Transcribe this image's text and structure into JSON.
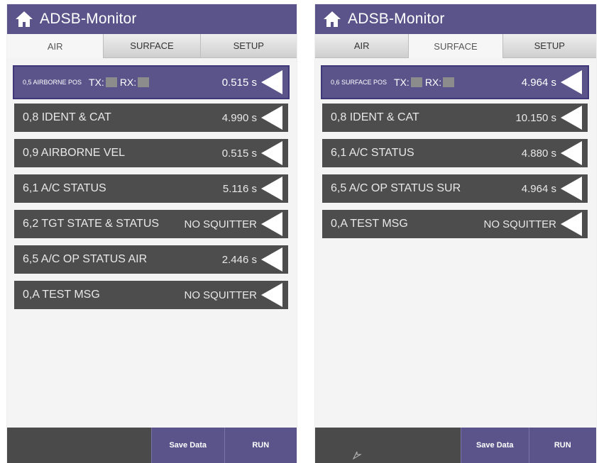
{
  "left": {
    "title": "ADSB-Monitor",
    "tabs": [
      "AIR",
      "SURFACE",
      "SETUP"
    ],
    "active_tab": "AIR",
    "selected": {
      "label": "0,5 AIRBORNE POS",
      "tx": "TX:",
      "rx": "RX:",
      "value": "0.515 s"
    },
    "rows": [
      {
        "label": "0,8 IDENT & CAT",
        "value": "4.990 s"
      },
      {
        "label": "0,9 AIRBORNE VEL",
        "value": "0.515 s"
      },
      {
        "label": "6,1 A/C STATUS",
        "value": "5.116 s"
      },
      {
        "label": "6,2 TGT STATE & STATUS",
        "value": "NO SQUITTER"
      },
      {
        "label": "6,5 A/C OP STATUS AIR",
        "value": "2.446 s"
      },
      {
        "label": "0,A TEST MSG",
        "value": "NO SQUITTER"
      }
    ],
    "buttons": {
      "save": "Save Data",
      "run": "RUN"
    }
  },
  "right": {
    "title": "ADSB-Monitor",
    "tabs": [
      "AIR",
      "SURFACE",
      "SETUP"
    ],
    "active_tab": "SURFACE",
    "selected": {
      "label": "0,6 SURFACE POS",
      "tx": "TX:",
      "rx": "RX:",
      "value": "4.964 s"
    },
    "rows": [
      {
        "label": "0,8 IDENT & CAT",
        "value": "10.150 s"
      },
      {
        "label": "6,1 A/C STATUS",
        "value": "4.880 s"
      },
      {
        "label": "6,5 A/C OP STATUS SUR",
        "value": "4.964 s"
      },
      {
        "label": "0,A TEST MSG",
        "value": "NO SQUITTER"
      }
    ],
    "buttons": {
      "save": "Save Data",
      "run": "RUN"
    }
  },
  "colors": {
    "accent": "#5b548a",
    "row_bg": "#4d4d4d",
    "led": "#8c8c8c"
  },
  "icons": {
    "home": "home-icon",
    "arrow": "left-arrow-icon",
    "cursor": "cursor-icon"
  }
}
